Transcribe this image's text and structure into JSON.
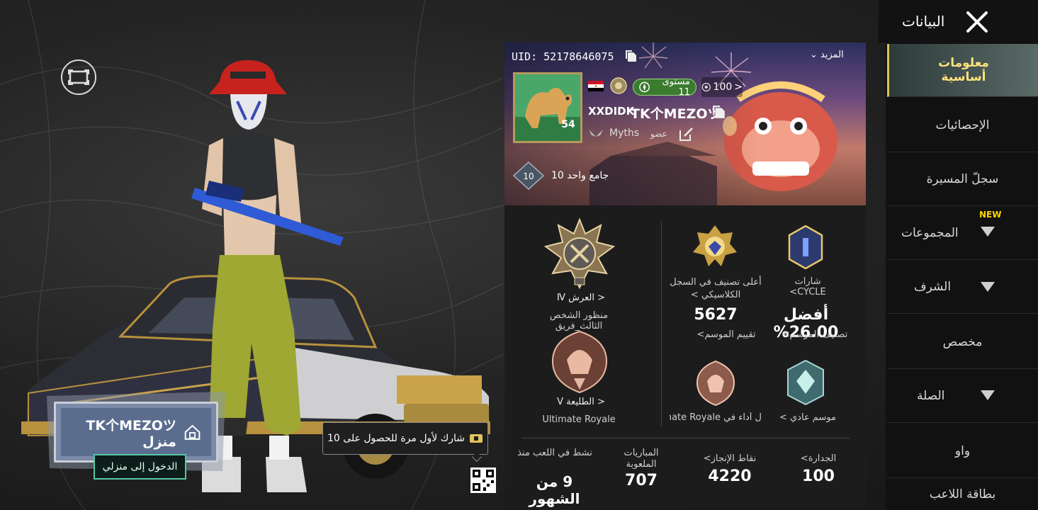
{
  "header": {
    "title": "البيانات"
  },
  "sidebar": {
    "items": [
      {
        "label": "معلومات أساسية"
      },
      {
        "label": "الإحصائيات"
      },
      {
        "label": "سجلّ المسيرة"
      },
      {
        "label": "المجموعات",
        "badge": "NEW"
      },
      {
        "label": "الشرف"
      },
      {
        "label": "مخصص"
      },
      {
        "label": "الصلة"
      },
      {
        "label": "واو"
      },
      {
        "label": "بطاقة اللاعب"
      }
    ]
  },
  "showcase": {
    "home_name": "TK个MEZOツ منزل",
    "enter_home": "الدخول إلى منزلي",
    "share_text": "شارك لأول مرة للحصول على 10"
  },
  "profile": {
    "uid": "UID: 52178646075",
    "more": "المزيد",
    "level_label": "مستوى 11",
    "popularity": "100",
    "avatar_level": "54",
    "clan_tag": "XXDIDK",
    "player_name": "TK个MEZOツ",
    "crew_name": "Myths",
    "crew_role": "عضو",
    "collector": "جامع واحد 10",
    "collector_badge": "10"
  },
  "stats": {
    "cycle_badges": "شارات CYCLE>",
    "top_classic_rank": "أعلى تصنيف في السجل الكلاسيكي >",
    "throne_rank": "< العرش Ⅳ",
    "tpp_squad": "منظور الشخص الثالث_فريق",
    "best_pct": "أفضل 26.00%",
    "season_rank_label": "تصنيف الموسم>",
    "season_rating": "5627",
    "season_rating_label": "تقييم الموسم>",
    "normal_season": "موسم عادي >",
    "best_perf": "ل أداء في Ultimate Royale",
    "vanguard_rank": "< الطليعة Ⅴ",
    "ultimate_royale": "Ultimate Royale",
    "merit_label": "الجدارة>",
    "merit_value": "100",
    "achievement_label": "نقاط الإنجاز>",
    "achievement_value": "4220",
    "matches_label": "المباريات الملعوبة",
    "matches_value": "707",
    "active_label": "نشط في اللعب منذ",
    "active_value": "9 من الشهور"
  },
  "colors": {
    "accent": "#e0c15a",
    "home_board": "#5a6d8f",
    "enter_home_border": "#56c7a4",
    "level_green": "#3a7b2f"
  }
}
